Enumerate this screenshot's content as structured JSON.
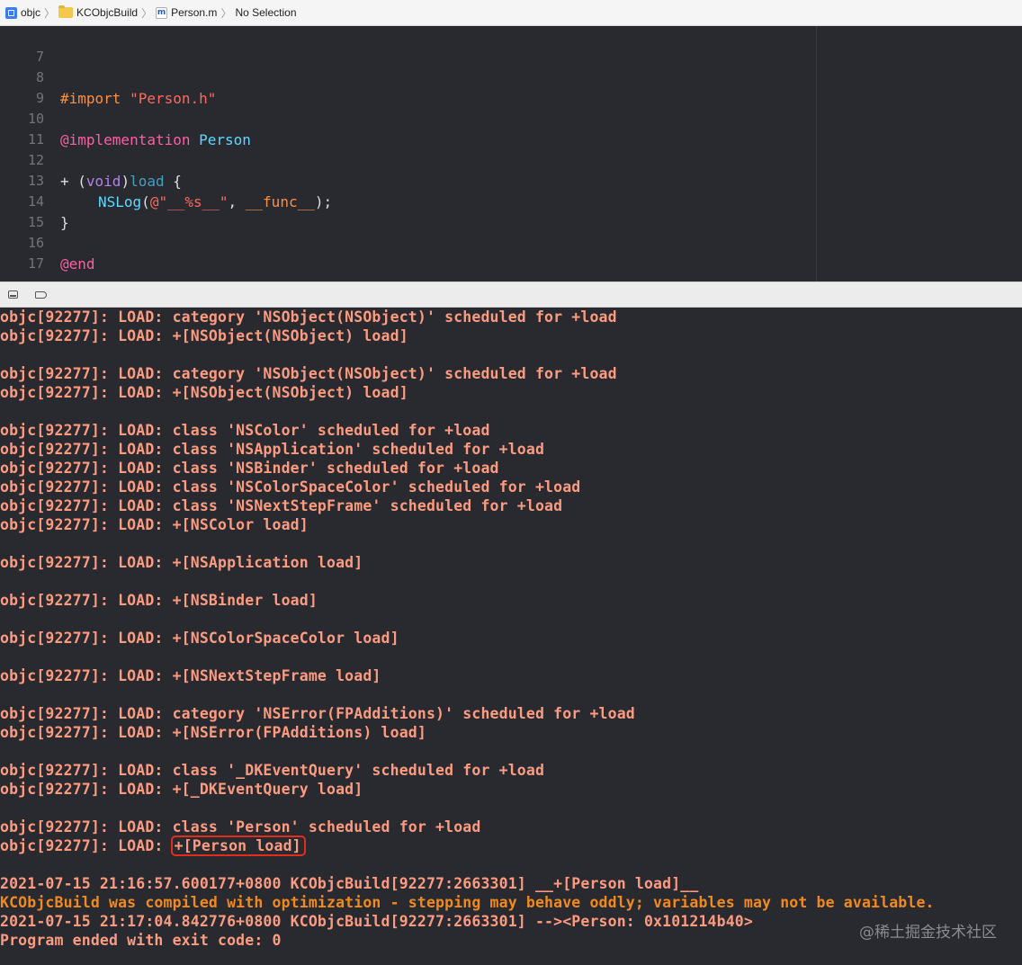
{
  "jumpbar": {
    "items": [
      {
        "label": "objc",
        "icon": "project-icon"
      },
      {
        "label": "KCObjcBuild",
        "icon": "folder-icon"
      },
      {
        "label": "Person.m",
        "icon": "m-file-icon",
        "icon_glyph": "m"
      },
      {
        "label": "No Selection"
      }
    ]
  },
  "editor": {
    "line_numbers": [
      "7",
      "8",
      "9",
      "10",
      "11",
      "12",
      "13",
      "14",
      "15",
      "16",
      "17"
    ],
    "lines": {
      "l8_directive": "#import",
      "l8_string": "\"Person.h\"",
      "l10_keyword": "@implementation",
      "l10_class": "Person",
      "l12_plus": "+ (",
      "l12_void": "void",
      "l12_close": ")",
      "l12_method": "load",
      "l12_brace": " {",
      "l13_fn": "NSLog",
      "l13_open": "(",
      "l13_string": "@\"__%s__\"",
      "l13_comma": ", ",
      "l13_macro": "__func__",
      "l13_end": ");",
      "l14_brace": "}",
      "l16_keyword": "@end"
    }
  },
  "console": {
    "lines": [
      "objc[92277]: LOAD: category 'NSObject(NSObject)' scheduled for +load",
      "objc[92277]: LOAD: +[NSObject(NSObject) load]",
      "",
      "objc[92277]: LOAD: category 'NSObject(NSObject)' scheduled for +load",
      "objc[92277]: LOAD: +[NSObject(NSObject) load]",
      "",
      "objc[92277]: LOAD: class 'NSColor' scheduled for +load",
      "objc[92277]: LOAD: class 'NSApplication' scheduled for +load",
      "objc[92277]: LOAD: class 'NSBinder' scheduled for +load",
      "objc[92277]: LOAD: class 'NSColorSpaceColor' scheduled for +load",
      "objc[92277]: LOAD: class 'NSNextStepFrame' scheduled for +load",
      "objc[92277]: LOAD: +[NSColor load]",
      "",
      "objc[92277]: LOAD: +[NSApplication load]",
      "",
      "objc[92277]: LOAD: +[NSBinder load]",
      "",
      "objc[92277]: LOAD: +[NSColorSpaceColor load]",
      "",
      "objc[92277]: LOAD: +[NSNextStepFrame load]",
      "",
      "objc[92277]: LOAD: category 'NSError(FPAdditions)' scheduled for +load",
      "objc[92277]: LOAD: +[NSError(FPAdditions) load]",
      "",
      "objc[92277]: LOAD: class '_DKEventQuery' scheduled for +load",
      "objc[92277]: LOAD: +[_DKEventQuery load]",
      "",
      "objc[92277]: LOAD: class 'Person' scheduled for +load"
    ],
    "highlight_prefix": "objc[92277]: LOAD: ",
    "highlight_text": "+[Person load]",
    "blank_after_highlight": "",
    "log_line_1": "2021-07-15 21:16:57.600177+0800 KCObjcBuild[92277:2663301] __+[Person load]__",
    "warning_line": "KCObjcBuild was compiled with optimization - stepping may behave oddly; variables may not be available.",
    "log_line_2": "2021-07-15 21:17:04.842776+0800 KCObjcBuild[92277:2663301] --><Person: 0x101214b40>",
    "exit_line": "Program ended with exit code: 0"
  },
  "watermark": "@稀土掘金技术社区",
  "colors": {
    "editor_bg": "#292a30",
    "console_text": "#fc9b80",
    "warning_text": "#f08a1e",
    "highlight_border": "#e02d1c"
  }
}
